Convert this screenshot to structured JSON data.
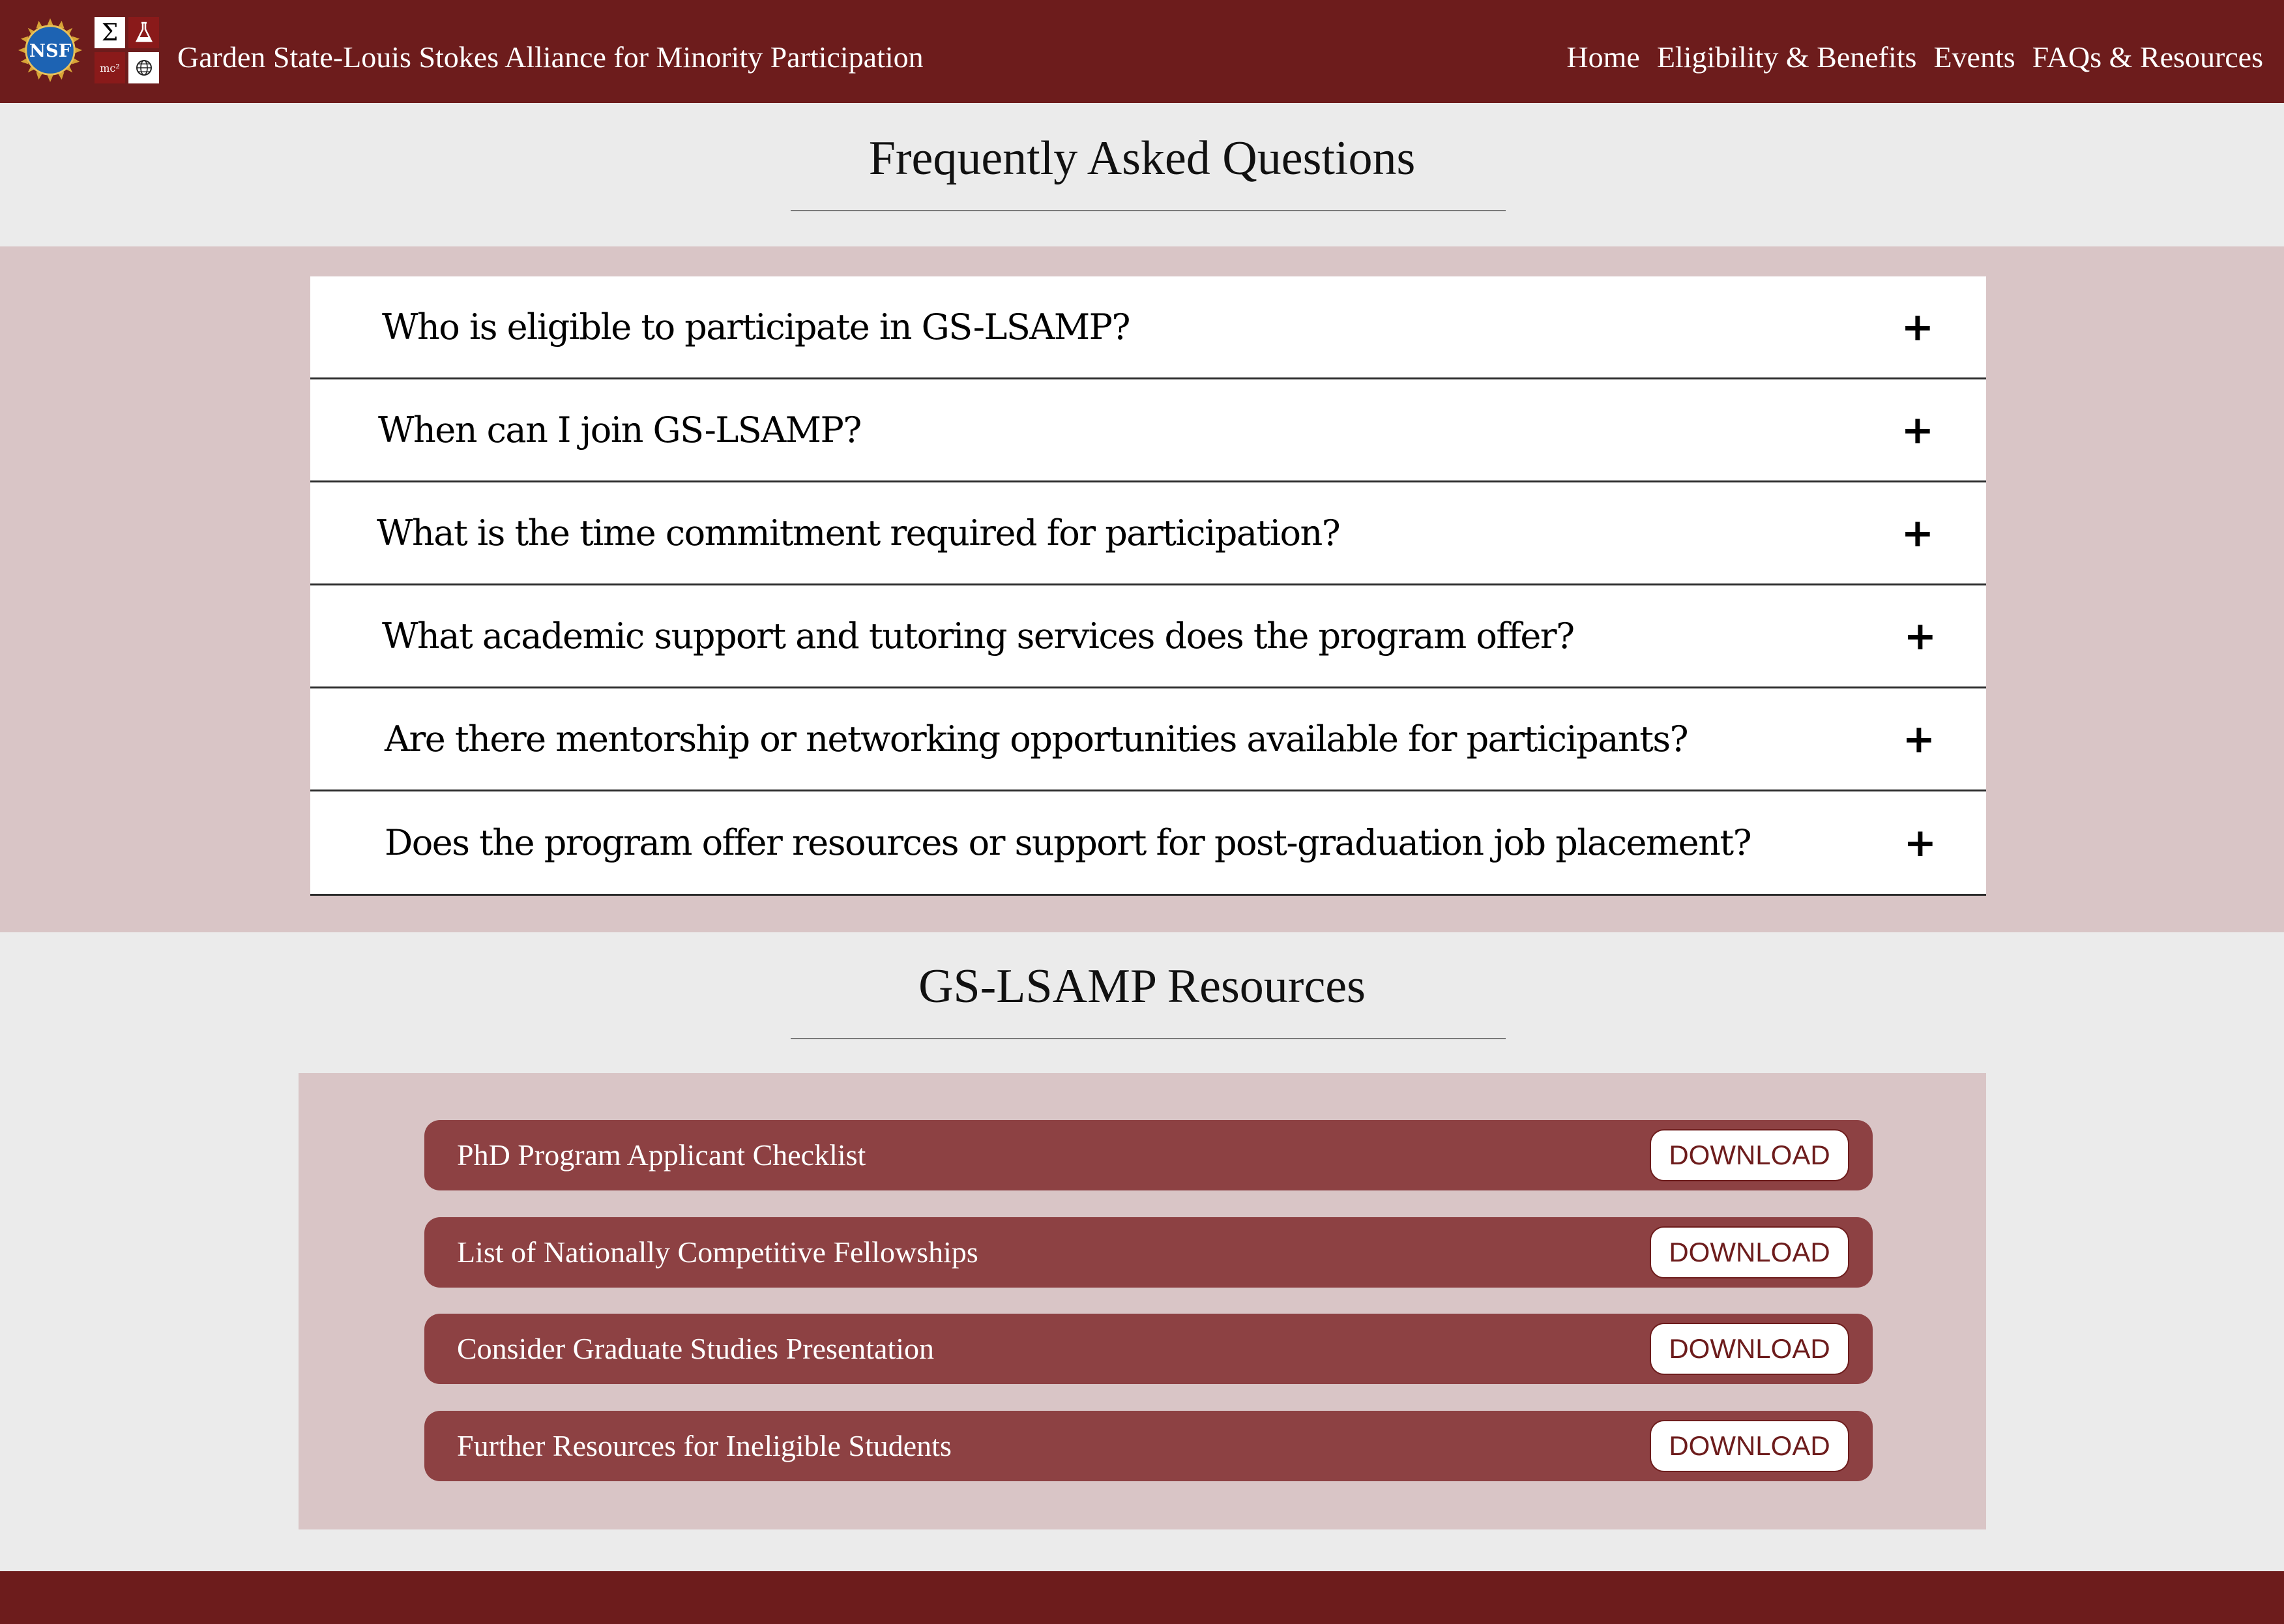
{
  "header": {
    "title": "Garden State-Louis Stokes Alliance for Minority Participation",
    "nsf_logo_text": "NSF",
    "nav": [
      "Home",
      "Eligibility & Benefits",
      "Events",
      "FAQs & Resources"
    ]
  },
  "faq": {
    "title": "Frequently Asked Questions",
    "items": [
      {
        "question": "Who is eligible to participate in GS-LSAMP?",
        "toggle": "+"
      },
      {
        "question": "When can I join GS-LSAMP?",
        "toggle": "+"
      },
      {
        "question": "What is the time commitment required for participation?",
        "toggle": "+"
      },
      {
        "question": "What academic support and tutoring services does the program offer?",
        "toggle": "+"
      },
      {
        "question": "Are there mentorship or networking opportunities available for participants?",
        "toggle": "+"
      },
      {
        "question": "Does the program offer resources or support for post-graduation job placement?",
        "toggle": "+"
      }
    ]
  },
  "resources": {
    "title": "GS-LSAMP Resources",
    "items": [
      {
        "label": "PhD Program Applicant Checklist",
        "button": "DOWNLOAD"
      },
      {
        "label": "List of Nationally Competitive Fellowships",
        "button": "DOWNLOAD"
      },
      {
        "label": "Consider Graduate Studies Presentation",
        "button": "DOWNLOAD"
      },
      {
        "label": "Further Resources for Ineligible Students",
        "button": "DOWNLOAD"
      }
    ]
  },
  "colors": {
    "header_bg": "#6d1c1c",
    "faq_band": "#d9c5c6",
    "resource_row": "#8d4143",
    "page_bg": "#ebebeb"
  }
}
